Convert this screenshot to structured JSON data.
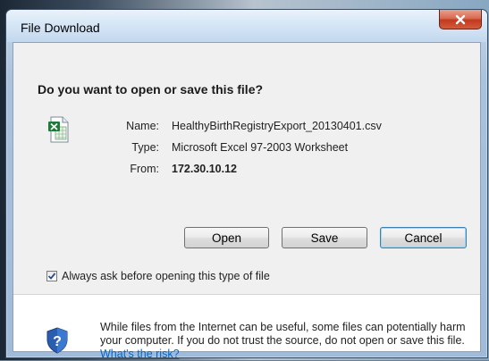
{
  "window": {
    "title": "File Download"
  },
  "dialog": {
    "question": "Do you want to open or save this file?",
    "file": {
      "icon": "excel-file-icon",
      "name_label": "Name:",
      "name": "HealthyBirthRegistryExport_20130401.csv",
      "type_label": "Type:",
      "type": "Microsoft Excel 97-2003 Worksheet",
      "from_label": "From:",
      "from": "172.30.10.12"
    },
    "buttons": {
      "open": "Open",
      "save": "Save",
      "cancel": "Cancel"
    },
    "always_ask": {
      "label": "Always ask before opening this type of file",
      "checked": true
    },
    "warning": {
      "icon": "shield-question-icon",
      "text": "While files from the Internet can be useful, some files can potentially harm your computer. If you do not trust the source, do not open or save this file.",
      "link": "What's the risk?"
    }
  },
  "colors": {
    "close_button": "#c2391e",
    "link": "#0066cc",
    "default_button_border": "#3c7fb1"
  }
}
